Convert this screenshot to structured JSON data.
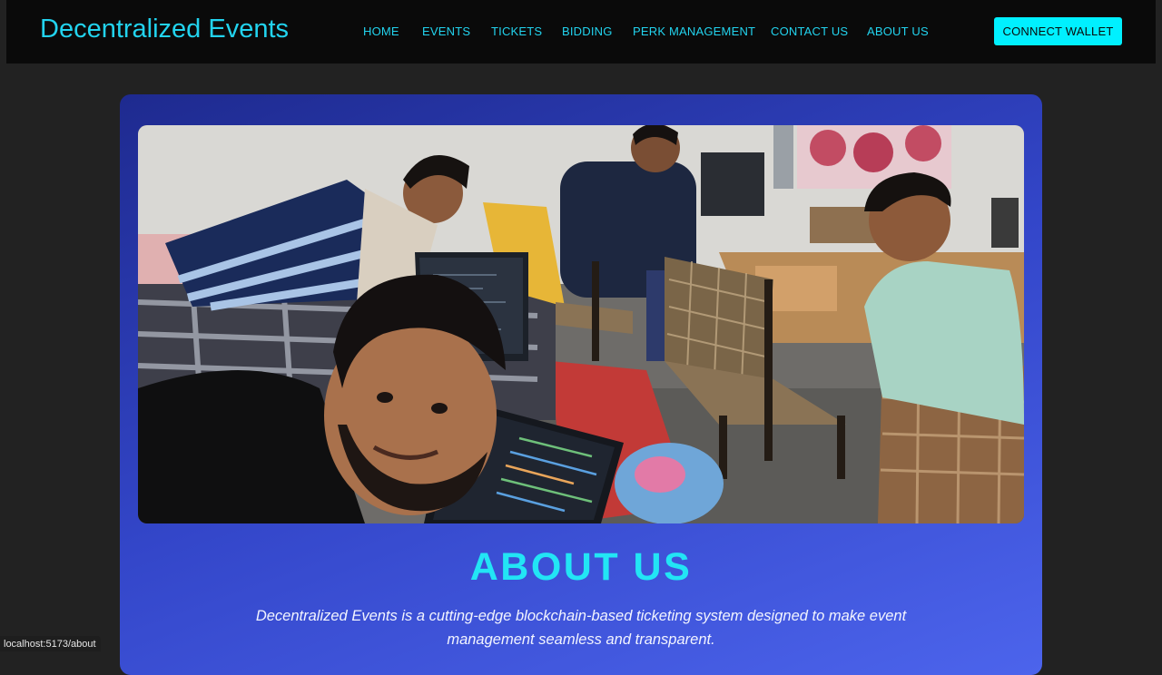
{
  "navbar": {
    "brand": "Decentralized Events",
    "links": [
      "HOME",
      "EVENTS",
      "TICKETS",
      "BIDDING",
      "PERK MANAGEMENT",
      "CONTACT US",
      "ABOUT US"
    ],
    "wallet_button": "CONNECT WALLET"
  },
  "about": {
    "title": "ABOUT US",
    "description": "Decentralized Events is a cutting-edge blockchain-based ticketing system designed to make event management seamless and transparent."
  },
  "status_bar": {
    "url": "localhost:5173/about"
  },
  "colors": {
    "accent": "#22d3ee",
    "button": "#00f0ff",
    "page_bg": "#222222",
    "nav_bg": "#0a0a0a",
    "card_gradient_start": "#1e2a8f",
    "card_gradient_end": "#4c64ec"
  }
}
